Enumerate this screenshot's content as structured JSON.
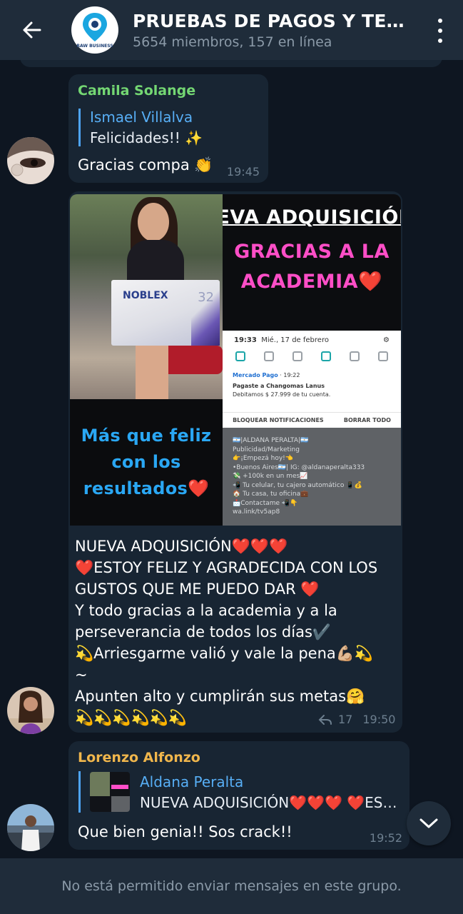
{
  "header": {
    "title": "PRUEBAS DE PAGOS Y TE…",
    "subtitle": "5654 miembros, 157 en línea",
    "avatar_caption": "RAW BUSINESS",
    "accent": "#1f2c3a"
  },
  "messages": [
    {
      "sender": "Camila Solange",
      "sender_color": "#74d773",
      "reply_to": {
        "name": "Ismael Villalva",
        "text": "Felicidades!! ✨"
      },
      "text": "Gracias compa 👏",
      "time": "19:45"
    },
    {
      "image": {
        "headline_1": "NUEVA ADQUISICIÓN✔️",
        "headline_2": "GRACIAS A LA ACADEMIA❤️",
        "bottom_left": "Más que feliz con los resultados❤️",
        "tv_brand": "NOBLEX",
        "tv_size": "32",
        "phone": {
          "clock": "19:33",
          "date": "Mié., 17 de febrero",
          "app": "Mercado Pago",
          "app_time": "19:22",
          "notif_title": "Pagaste a Changomas Lanus",
          "notif_body": "Debitamos $ 27.999 de tu cuenta.",
          "btn_block": "BLOQUEAR NOTIFICACIONES",
          "btn_clear": "BORRAR TODO"
        },
        "profile_lines": [
          "🇦🇷|ALDANA PERALTA|🇦🇷",
          "Publicidad/Marketing",
          "👉¡Empezá hoy!👈",
          "•Buenos Aires🇦🇷| IG: @aldanaperalta333",
          "💸 +100k  en un mes📈",
          "📲 Tu celular, tu cajero automático 📱💰",
          "🏠 Tu casa, tu oficina💼",
          "📩Contactame 📲👇",
          "wa.link/tv5ap8"
        ]
      },
      "text_lines": [
        "NUEVA ADQUISICIÓN❤️❤️❤️",
        "❤️ESTOY FELIZ Y AGRADECIDA CON LOS",
        "GUSTOS QUE ME PUEDO DAR ❤️",
        "Y todo gracias a la academia y a la",
        "perseverancia de todos los días✔️",
        "💫Arriesgarme valió y vale la pena💪🏼💫",
        "~",
        "Apunten alto y cumplirán sus metas🤗",
        "💫💫💫💫💫💫"
      ],
      "forwards": "17",
      "time": "19:50"
    },
    {
      "sender": "Lorenzo Alfonzo",
      "sender_color": "#f0b64c",
      "reply_to": {
        "name": "Aldana Peralta",
        "text": "NUEVA ADQUISICIÓN❤️❤️❤️ ❤️ES…"
      },
      "text": "Que bien genia!! Sos crack!!",
      "time": "19:52"
    }
  ],
  "footer": {
    "notice": "No está permitido enviar mensajes en este grupo."
  }
}
